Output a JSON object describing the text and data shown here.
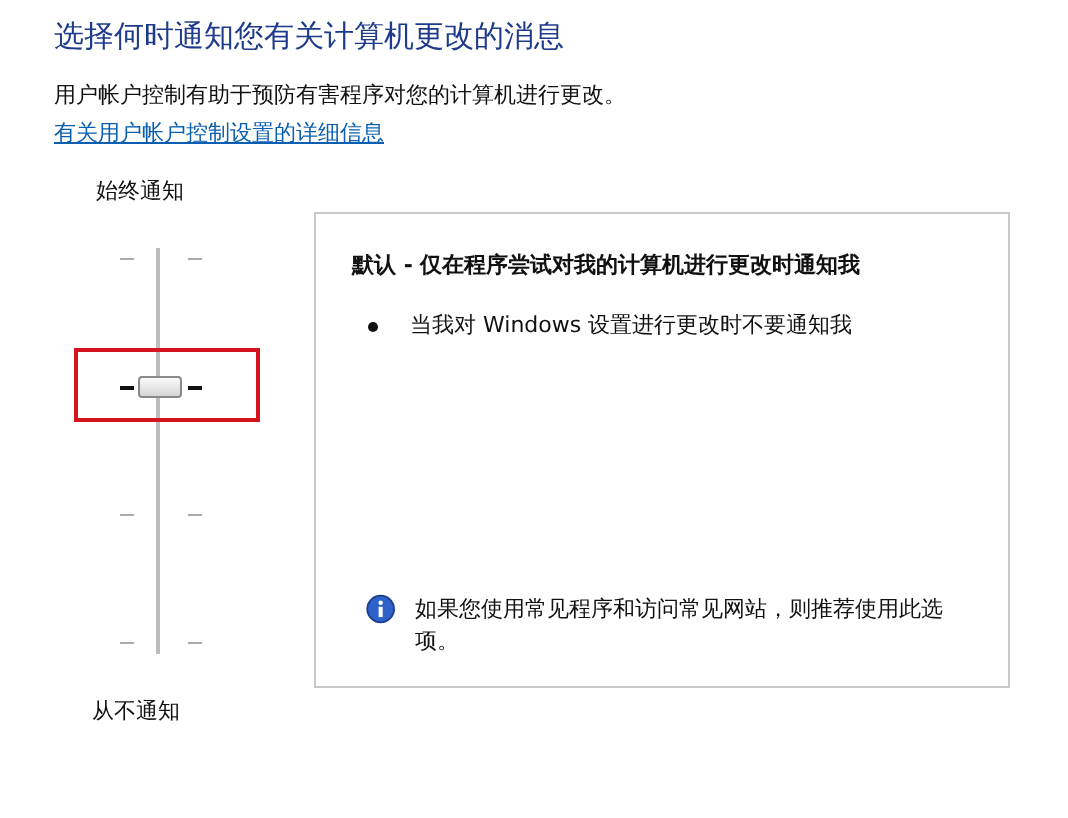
{
  "title": "选择何时通知您有关计算机更改的消息",
  "description": "用户帐户控制有助于预防有害程序对您的计算机进行更改。",
  "link": "有关用户帐户控制设置的详细信息",
  "slider": {
    "top_label": "始终通知",
    "bottom_label": "从不通知",
    "level": 0.667
  },
  "panel": {
    "heading": "默认 - 仅在程序尝试对我的计算机进行更改时通知我",
    "bullets": [
      "当我对 Windows 设置进行更改时不要通知我"
    ],
    "info": "如果您使用常见程序和访问常见网站，则推荐使用此选项。"
  }
}
